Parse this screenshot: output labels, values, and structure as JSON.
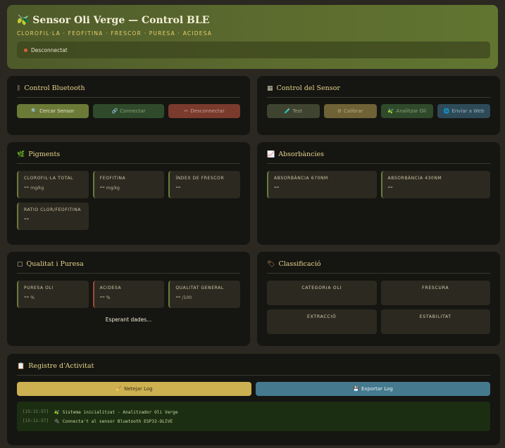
{
  "header": {
    "title": "🫒 Sensor Oli Verge — Control BLE",
    "subtitle": "CLOROFIL·LA · FEOFITINA · FRESCOR · PURESA · ACIDESA",
    "status": "Desconnectat",
    "status_color": "#d9603a"
  },
  "bluetooth": {
    "title": "Control Bluetooth",
    "icon": "bluetooth-icon",
    "buttons": [
      {
        "label": "Cercar Sensor",
        "icon": "🔍"
      },
      {
        "label": "Connectar",
        "icon": "🔗"
      },
      {
        "label": "Desconnectar",
        "icon": "✂"
      }
    ]
  },
  "sensor_control": {
    "title": "Control del Sensor",
    "icon": "control-icon",
    "buttons": [
      {
        "label": "Test",
        "icon": "🧪"
      },
      {
        "label": "Calibrar",
        "icon": "⚙"
      },
      {
        "label": "Analitzar Oli",
        "icon": "🫒"
      },
      {
        "label": "Enviar a Web",
        "icon": "🌐"
      }
    ]
  },
  "pigments": {
    "title": "Pigments",
    "icon": "leaf-icon",
    "metrics": [
      {
        "label": "CLOROFIL·LA TOTAL",
        "value": "--",
        "unit": "mg/kg"
      },
      {
        "label": "FEOFITINA",
        "value": "--",
        "unit": "mg/kg"
      },
      {
        "label": "ÍNDEX DE FRESCOR",
        "value": "--",
        "unit": ""
      },
      {
        "label": "RATIO CLOR/FEOFITINA",
        "value": "--",
        "unit": ""
      }
    ]
  },
  "absorbances": {
    "title": "Absorbàncies",
    "icon": "chart-icon",
    "metrics": [
      {
        "label": "ABSORBÀNCIA 670NM",
        "value": "--"
      },
      {
        "label": "ABSORBÀNCIA 430NM",
        "value": "--"
      }
    ]
  },
  "quality": {
    "title": "Qualitat i Puresa",
    "icon": "quality-icon",
    "metrics": [
      {
        "label": "PURESA OLI",
        "value": "--",
        "unit": "%"
      },
      {
        "label": "ACIDESA",
        "value": "--",
        "unit": "%"
      },
      {
        "label": "QUALITAT GENERAL",
        "value": "--",
        "unit": "/100"
      }
    ],
    "waiting": "Esperant dades..."
  },
  "classification": {
    "title": "Classificació",
    "icon": "tag-icon",
    "boxes": [
      "CATEGORIA OLI",
      "FRESCURA",
      "EXTRACCIÓ",
      "ESTABILITAT"
    ]
  },
  "log": {
    "title": "Registre d'Activitat",
    "icon": "clipboard-icon",
    "clear_label": "Netejar Log",
    "export_label": "Exportar Log",
    "lines": [
      {
        "time": "[15:11:57]",
        "text": "🫒 Sistema inicialitzat - Analitzador Oli Verge"
      },
      {
        "time": "[15:11:57]",
        "text": "🔌 Connecta't al sensor Bluetooth ESP32-OLIVE"
      }
    ]
  },
  "colors": {
    "btn_olive": "#6b7a36",
    "btn_green": "#2f4a2a",
    "btn_red": "#7a3a2c",
    "btn_khaki": "#3e4430",
    "btn_tan": "#6e6236",
    "btn_steel": "#2e4a58",
    "log_clear": "#cdb050",
    "log_export": "#44798e"
  }
}
